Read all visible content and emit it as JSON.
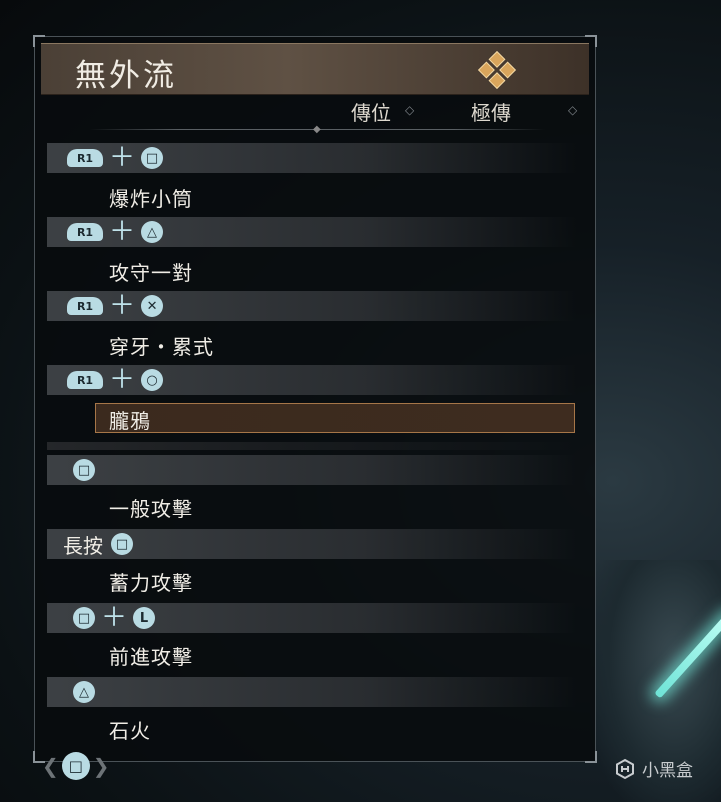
{
  "panel": {
    "title": "無外流",
    "header_left": "傳位",
    "header_right": "極傳"
  },
  "moves": [
    {
      "prefix": "",
      "buttons": [
        "R1",
        "□"
      ],
      "name": "爆炸小筒",
      "selected": false
    },
    {
      "prefix": "",
      "buttons": [
        "R1",
        "△"
      ],
      "name": "攻守一對",
      "selected": false
    },
    {
      "prefix": "",
      "buttons": [
        "R1",
        "✕"
      ],
      "name": "穿牙・累式",
      "selected": false
    },
    {
      "prefix": "",
      "buttons": [
        "R1",
        "○"
      ],
      "name": "朧鴉",
      "selected": true
    },
    {
      "prefix": "",
      "buttons": [
        "□"
      ],
      "name": "一般攻擊",
      "selected": false
    },
    {
      "prefix": "長按",
      "buttons": [
        "□"
      ],
      "name": "蓄力攻擊",
      "selected": false
    },
    {
      "prefix": "",
      "buttons": [
        "□",
        "L"
      ],
      "name": "前進攻擊",
      "selected": false
    },
    {
      "prefix": "",
      "buttons": [
        "△"
      ],
      "name": "石火",
      "selected": false
    }
  ],
  "footer": {
    "nav_button": "□"
  },
  "watermark": "小黑盒",
  "colors": {
    "button_fill": "#b9dbe3",
    "selected_border": "#a67648",
    "title_bar": "#5f5144"
  }
}
